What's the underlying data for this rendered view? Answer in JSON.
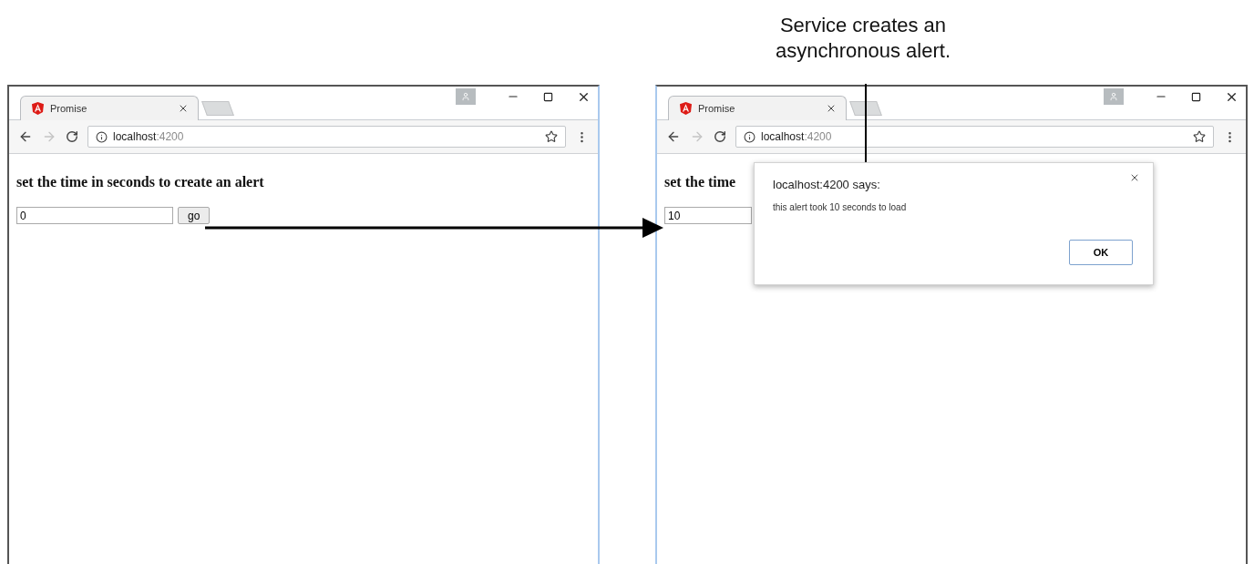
{
  "caption_lines": [
    "Service creates an",
    "asynchronous alert."
  ],
  "browsers": [
    {
      "tab_title": "Promise",
      "back_disabled": false,
      "forward_disabled": true,
      "url_host": "localhost",
      "url_port": ":4200",
      "heading": "set the time in seconds to create an alert",
      "input_value": "0",
      "button": "go"
    },
    {
      "tab_title": "Promise",
      "back_disabled": false,
      "forward_disabled": true,
      "url_host": "localhost",
      "url_port": ":4200",
      "heading": "set the time",
      "input_value": "10"
    }
  ],
  "dialog": {
    "title": "localhost:4200 says:",
    "message": "this alert took 10 seconds to load",
    "button": "OK"
  }
}
